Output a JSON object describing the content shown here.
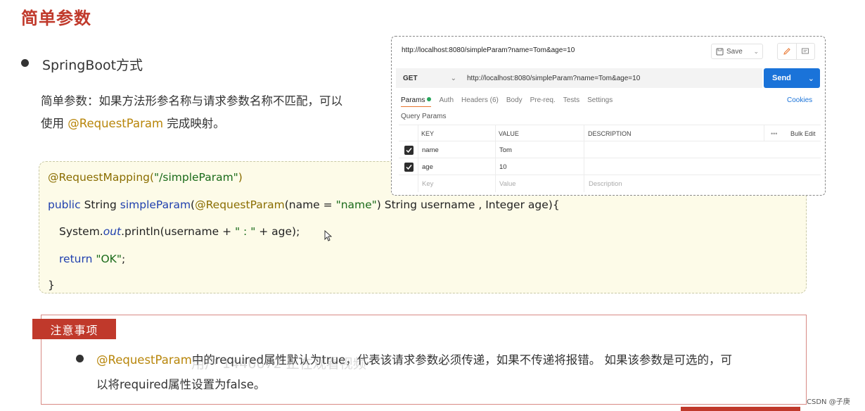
{
  "slide": {
    "title": "简单参数",
    "bullet": "SpringBoot方式",
    "desc_line1": "简单参数：如果方法形参名称与请求参数名称不匹配，可以",
    "desc_line2_pre": "使用 ",
    "desc_line2_hl": "@RequestParam",
    "desc_line2_post": " 完成映射。"
  },
  "code": {
    "l1_ann": "@RequestMapping(",
    "l1_str": "\"/simpleParam\"",
    "l1_end": ")",
    "l2_kw": "public",
    "l2_a": " String ",
    "l2_fn": "simpleParam",
    "l2_b": "(",
    "l2_ann": "@RequestParam",
    "l2_c": "(name = ",
    "l2_str": "\"name\"",
    "l2_d": ") String username , Integer age){",
    "l3_a": "System.",
    "l3_out": "out",
    "l3_b": ".println(username + ",
    "l3_str": "\" : \"",
    "l3_c": " + age);",
    "l4_kw": "return",
    "l4_sp": " ",
    "l4_str": "\"OK\"",
    "l4_end": ";",
    "l5": "}"
  },
  "postman": {
    "title_url": "http://localhost:8080/simpleParam?name=Tom&age=10",
    "save": "Save",
    "method": "GET",
    "url": "http://localhost:8080/simpleParam?name=Tom&age=10",
    "send": "Send",
    "tabs": [
      "Params",
      "Auth",
      "Headers (6)",
      "Body",
      "Pre-req.",
      "Tests",
      "Settings"
    ],
    "cookies": "Cookies",
    "query_params": "Query Params",
    "headers": {
      "key": "KEY",
      "value": "VALUE",
      "description": "DESCRIPTION",
      "more": "•••",
      "bulk": "Bulk Edit"
    },
    "rows": [
      {
        "key": "name",
        "value": "Tom"
      },
      {
        "key": "age",
        "value": "10"
      }
    ],
    "placeholders": {
      "key": "Key",
      "value": "Value",
      "description": "Description"
    }
  },
  "notice": {
    "tag": "注意事项",
    "hl": "@RequestParam",
    "text1": "中的required属性默认为true，代表该请求参数必须传递，如果不传递将报错。 如果该参数是可选的，可",
    "text2": "以将required属性设置为false。",
    "watermark": "用户 1446672 正在观看视频"
  },
  "footer": {
    "csdn": "CSDN @子庚"
  },
  "colors": {
    "accent": "#c0392b",
    "annotation": "#b8860b",
    "send": "#1a73d9"
  }
}
